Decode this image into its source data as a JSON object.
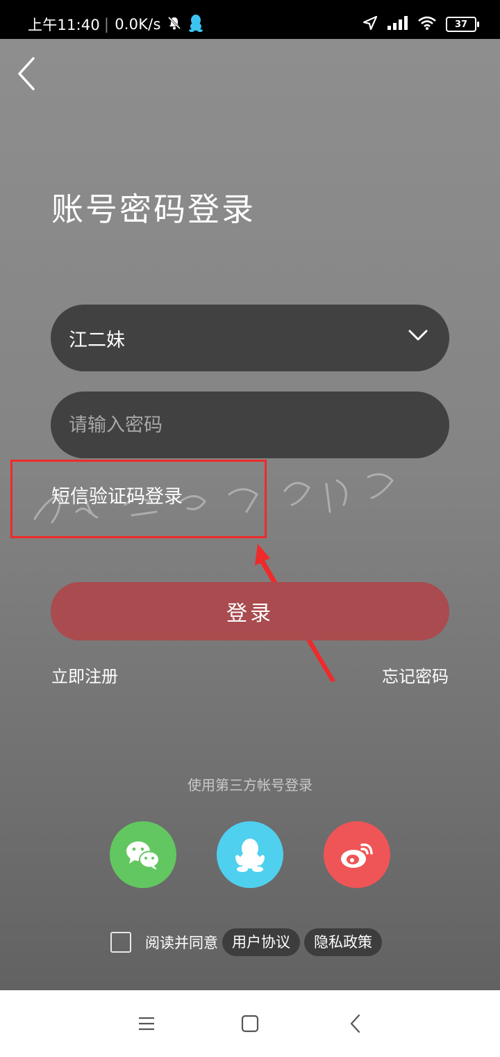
{
  "status_bar": {
    "time": "上午11:40",
    "net_speed": "0.0K/s",
    "battery": "37"
  },
  "icons": {
    "back": "chevron-left-icon",
    "dropdown": "chevron-down-icon",
    "wechat": "wechat-icon",
    "qq": "qq-penguin-icon",
    "weibo": "weibo-icon"
  },
  "login": {
    "title": "账号密码登录",
    "account_value": "江二妹",
    "password_placeholder": "请输入密码",
    "sms_login": "短信验证码登录",
    "login_button": "登录",
    "register": "立即注册",
    "forgot_password": "忘记密码"
  },
  "third_party": {
    "label": "使用第三方帐号登录"
  },
  "agreement": {
    "text": "阅读并同意",
    "user_agreement": "用户协议",
    "privacy_policy": "隐私政策"
  },
  "colors": {
    "background_top": "#8e8e8e",
    "background_bottom": "#626262",
    "field_bg": "#414141",
    "login_button": "#a94b4f",
    "highlight": "#ef2a2a",
    "wechat": "#62c760",
    "qq": "#4fd0ef",
    "weibo": "#ef5556"
  }
}
